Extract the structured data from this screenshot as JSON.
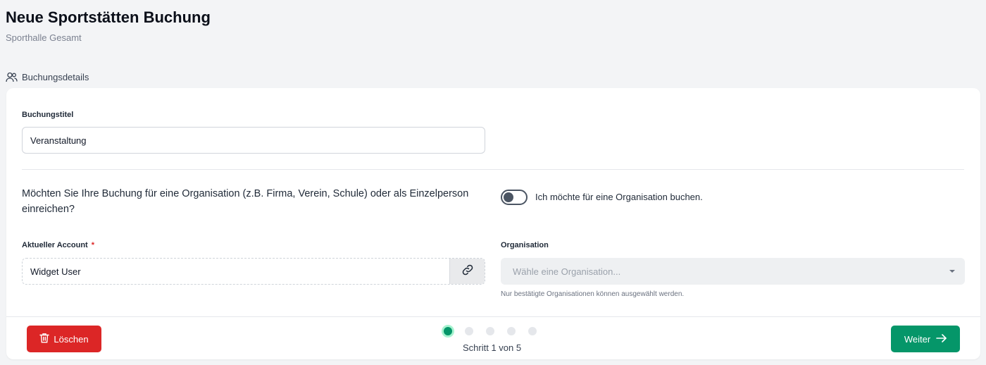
{
  "header": {
    "title": "Neue Sportstätten Buchung",
    "subtitle": "Sporthalle Gesamt"
  },
  "section": {
    "label": "Buchungsdetails",
    "icon": "users-icon"
  },
  "form": {
    "title_label": "Buchungstitel",
    "title_value": "Veranstaltung",
    "question": "Möchten Sie Ihre Buchung für eine Organisation (z.B. Firma, Verein, Schule) oder als Einzelperson einreichen?",
    "org_toggle_label": "Ich möchte für eine Organisation buchen.",
    "org_toggle_on": false,
    "account_label": "Aktueller Account",
    "account_required_mark": "*",
    "account_value": "Widget User",
    "account_link_icon": "link-icon",
    "organisation_label": "Organisation",
    "organisation_placeholder": "Wähle eine Organisation...",
    "organisation_hint": "Nur bestätigte Organisationen können ausgewählt werden."
  },
  "footer": {
    "delete_label": "Löschen",
    "delete_icon": "trash-icon",
    "next_label": "Weiter",
    "next_icon": "arrow-right-icon",
    "step_text": "Schritt 1 von 5",
    "current_step": 1,
    "total_steps": 5
  },
  "colors": {
    "primary_green": "#059669",
    "danger_red": "#dc2626",
    "background": "#f3f4f6"
  }
}
